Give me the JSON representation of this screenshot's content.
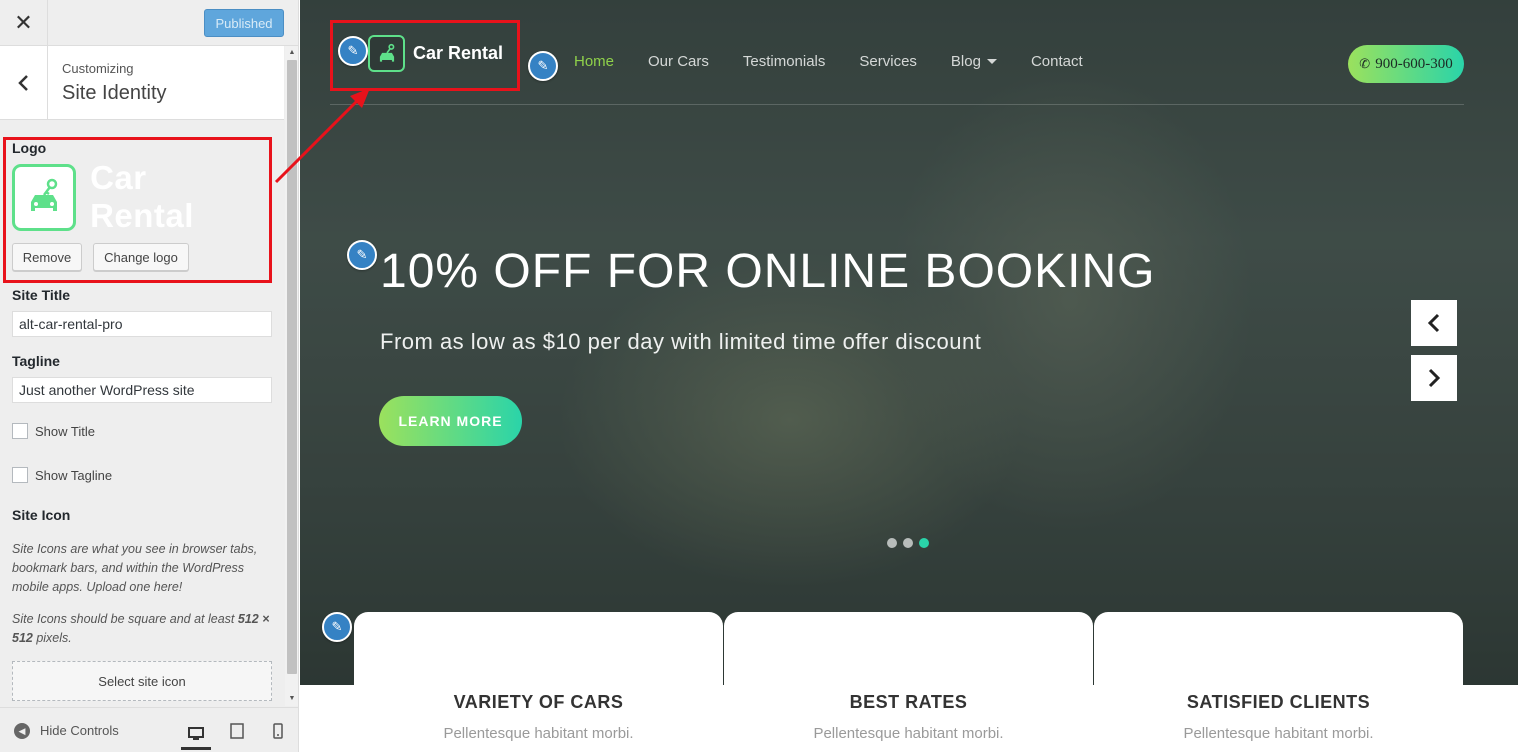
{
  "sidebar": {
    "header": {
      "close_icon": "close-icon",
      "publish_label": "Published"
    },
    "section": {
      "breadcrumb": "Customizing",
      "title": "Site Identity"
    },
    "logo": {
      "label": "Logo",
      "preview_text": "Car Rental",
      "remove_label": "Remove",
      "change_label": "Change logo"
    },
    "site_title": {
      "label": "Site Title",
      "value": "alt-car-rental-pro"
    },
    "tagline": {
      "label": "Tagline",
      "value": "Just another WordPress site"
    },
    "show_title": {
      "label": "Show Title",
      "checked": false
    },
    "show_tagline": {
      "label": "Show Tagline",
      "checked": false
    },
    "site_icon": {
      "label": "Site Icon",
      "desc1": "Site Icons are what you see in browser tabs, bookmark bars, and within the WordPress mobile apps. Upload one here!",
      "desc2_pre": "Site Icons should be square and at least ",
      "desc2_size": "512 × 512",
      "desc2_post": " pixels.",
      "select_label": "Select site icon"
    },
    "footer": {
      "hide_label": "Hide Controls"
    }
  },
  "preview": {
    "logo_text": "Car Rental",
    "nav": [
      {
        "label": "Home",
        "active": true
      },
      {
        "label": "Our Cars"
      },
      {
        "label": "Testimonials"
      },
      {
        "label": "Services"
      },
      {
        "label": "Blog"
      },
      {
        "label": "Contact"
      }
    ],
    "phone": "900-600-300",
    "hero": {
      "title": "10% OFF FOR ONLINE BOOKING",
      "subtitle": "From as low as $10 per day with limited time offer discount",
      "cta": "LEARN MORE"
    },
    "slider": {
      "prev": "‹",
      "next": "›",
      "active_dot": 3
    },
    "features": [
      {
        "title": "VARIETY OF CARS",
        "text": "Pellentesque habitant morbi."
      },
      {
        "title": "BEST RATES",
        "text": "Pellentesque habitant morbi."
      },
      {
        "title": "SATISFIED CLIENTS",
        "text": "Pellentesque habitant morbi."
      }
    ]
  },
  "colors": {
    "accent_green": "#8fd14a",
    "gradient_start": "#9be15d",
    "gradient_end": "#2ad4a9",
    "highlight_red": "#e8121b",
    "wp_blue": "#3582c4"
  }
}
